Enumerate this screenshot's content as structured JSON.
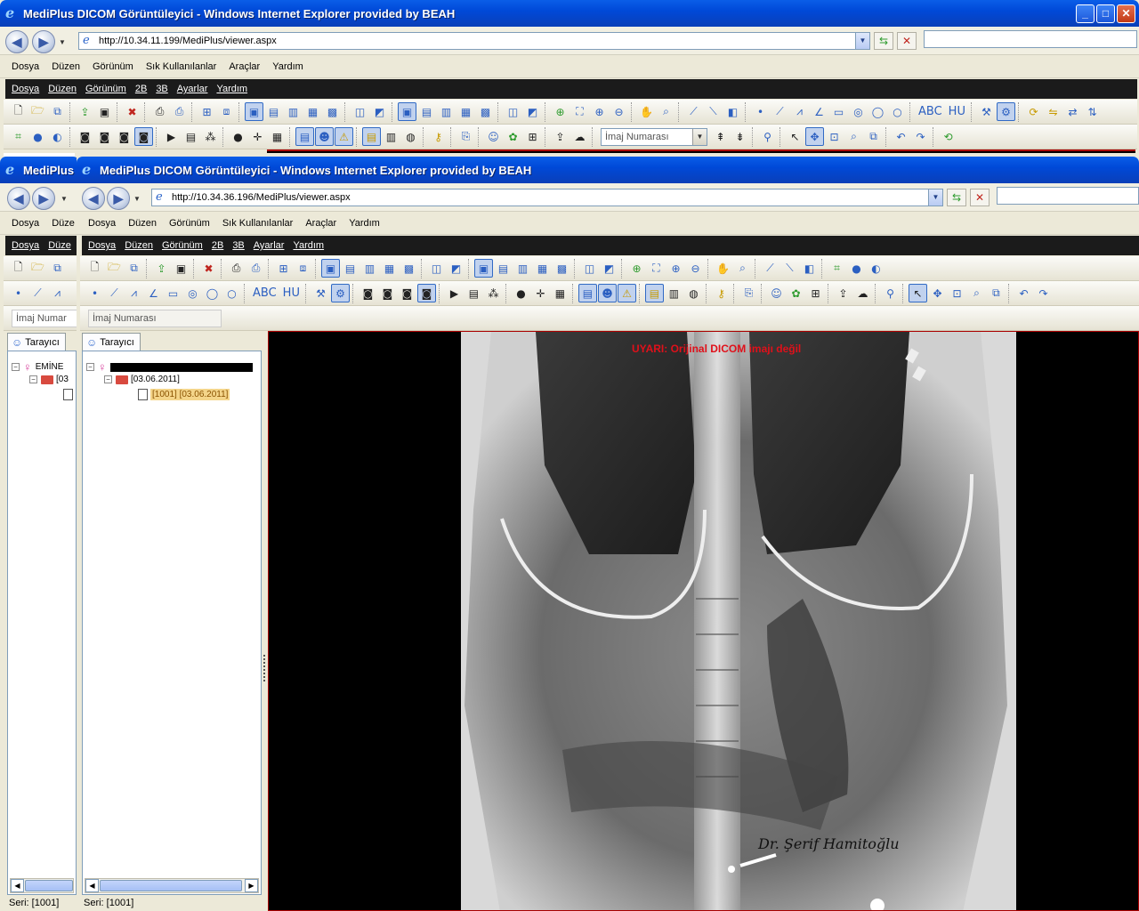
{
  "back_window": {
    "title": "MediPlus DICOM Görüntüleyici - Windows Internet Explorer provided by BEAH",
    "url": "http://10.34.11.199/MediPlus/viewer.aspx",
    "ie_menu": [
      "Dosya",
      "Düzen",
      "Görünüm",
      "Sık Kullanılanlar",
      "Araçlar",
      "Yardım"
    ],
    "app_menu": [
      "Dosya",
      "Düzen",
      "Görünüm",
      "2B",
      "3B",
      "Ayarlar",
      "Yardım"
    ],
    "image_number_placeholder": "İmaj Numarası",
    "tab_label": "Tarayıcı",
    "patient_name": "EMİNE",
    "study_date": "[03",
    "series_status": "Seri: [1001]",
    "partial_menu": [
      "Dosya",
      "Düze"
    ],
    "partial_image_number": "İmaj Numar",
    "partial_title": "MediPlus"
  },
  "front_window": {
    "title": "MediPlus DICOM Görüntüleyici - Windows Internet Explorer provided by BEAH",
    "url": "http://10.34.36.196/MediPlus/viewer.aspx",
    "ie_menu": [
      "Dosya",
      "Düzen",
      "Görünüm",
      "Sık Kullanılanlar",
      "Araçlar",
      "Yardım"
    ],
    "app_menu": [
      "Dosya",
      "Düzen",
      "Görünüm",
      "2B",
      "3B",
      "Ayarlar",
      "Yardım"
    ],
    "image_number_placeholder": "İmaj Numarası",
    "tab_label": "Tarayıcı",
    "study_date": "[03.06.2011]",
    "series_item": "[1001] [03.06.2011]",
    "series_status": "Seri: [1001]",
    "warning_text": "UYARI: Orijinal DICOM imajı değil",
    "signature": "Dr. Şerif Hamitoğlu"
  },
  "colors": {
    "title_blue": "#0049d8",
    "warning_red": "#e0101a",
    "viewer_border": "#aa0000"
  },
  "icons": {
    "back": "back-arrow-icon",
    "forward": "forward-arrow-icon",
    "refresh": "refresh-icon",
    "stop": "stop-icon",
    "ie": "ie-logo-icon"
  }
}
